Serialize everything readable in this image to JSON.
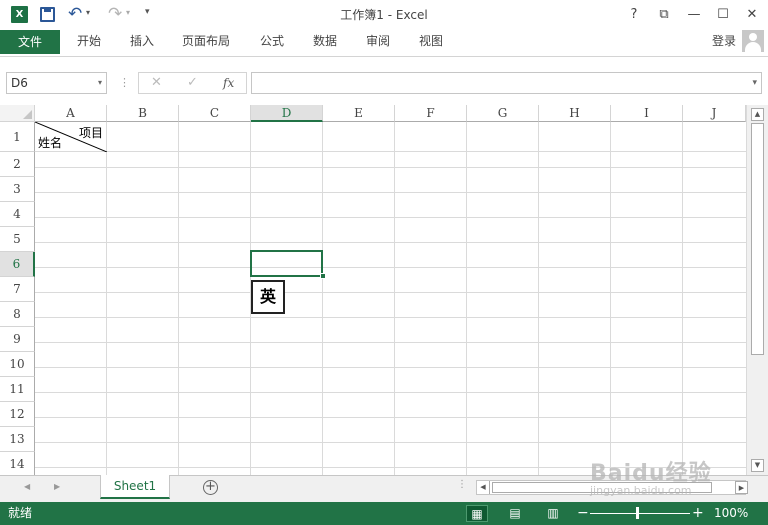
{
  "window": {
    "title": "工作簿1 - Excel",
    "app_icon": "X",
    "help": "?",
    "ribbon_display": "⧉",
    "minimize": "—",
    "maximize": "☐",
    "close": "✕"
  },
  "quick_access": {
    "undo": "↶",
    "redo": "↷",
    "dropdown": "▾",
    "customize": "▾"
  },
  "ribbon": {
    "file_tab": "文件",
    "tabs": [
      "开始",
      "插入",
      "页面布局",
      "公式",
      "数据",
      "审阅",
      "视图"
    ],
    "login": "登录"
  },
  "formula_bar": {
    "name_box": "D6",
    "name_box_dropdown": "▾",
    "dots": "⋮",
    "cancel": "✕",
    "enter": "✓",
    "fx": "fx",
    "value": "",
    "expand": "▾"
  },
  "sheet": {
    "columns": [
      "A",
      "B",
      "C",
      "D",
      "E",
      "F",
      "G",
      "H",
      "I",
      "J"
    ],
    "rows": [
      "1",
      "2",
      "3",
      "4",
      "5",
      "6",
      "7",
      "8",
      "9",
      "10",
      "11",
      "12",
      "13",
      "14"
    ],
    "selected_column": "D",
    "selected_row": "6",
    "header_cell": {
      "top_right": "项目",
      "bottom_left": "姓名"
    },
    "ime_indicator": "英"
  },
  "vscroll": {
    "up": "▲",
    "down": "▼"
  },
  "sheet_tabs": {
    "prev": "◀",
    "next": "▶",
    "active": "Sheet1",
    "add": "+",
    "dots": "⋮"
  },
  "hscroll": {
    "left": "◀",
    "right": "▶"
  },
  "status": {
    "text": "就绪",
    "zoom": "100%",
    "zoom_minus": "−",
    "zoom_plus": "+",
    "zoom_fraction": 0.5
  },
  "watermark": {
    "main": "Baidu经验",
    "sub": "jingyan.baidu.com"
  },
  "colors": {
    "accent": "#217346",
    "status_bg": "#217346",
    "gridline": "#dadada"
  },
  "icons": {
    "app": "excel-icon",
    "save": "save-icon",
    "undo": "undo-icon",
    "redo": "redo-icon",
    "avatar": "user-avatar-icon",
    "normal_view": "normal-view-icon",
    "page_layout_view": "page-layout-view-icon",
    "page_break_view": "page-break-view-icon"
  }
}
